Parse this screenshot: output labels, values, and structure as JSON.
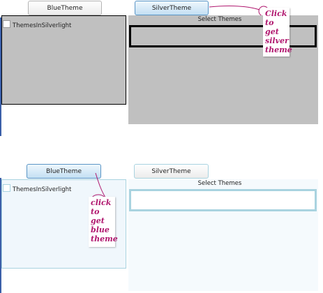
{
  "top_panel": {
    "theme": "silver",
    "blue_button": "BlueTheme",
    "silver_button": "SilverTheme",
    "checkbox_label": "ThemesInSilverlight",
    "select_label": "Select Themes",
    "annotation": [
      "Click",
      "to get",
      "silver",
      "theme"
    ]
  },
  "bottom_panel": {
    "theme": "blue",
    "blue_button": "BlueTheme",
    "silver_button": "SilverTheme",
    "checkbox_label": "ThemesInSilverlight",
    "select_label": "Select Themes",
    "annotation": [
      "click",
      "to get",
      "blue",
      "theme"
    ]
  },
  "colors": {
    "silver_panel": "#c0c0c0",
    "blue_panel_left": "#f0f7fc",
    "blue_panel_right": "#f5fafd",
    "blue_border": "#a9d3e0",
    "annotation_text": "#b0176e"
  }
}
